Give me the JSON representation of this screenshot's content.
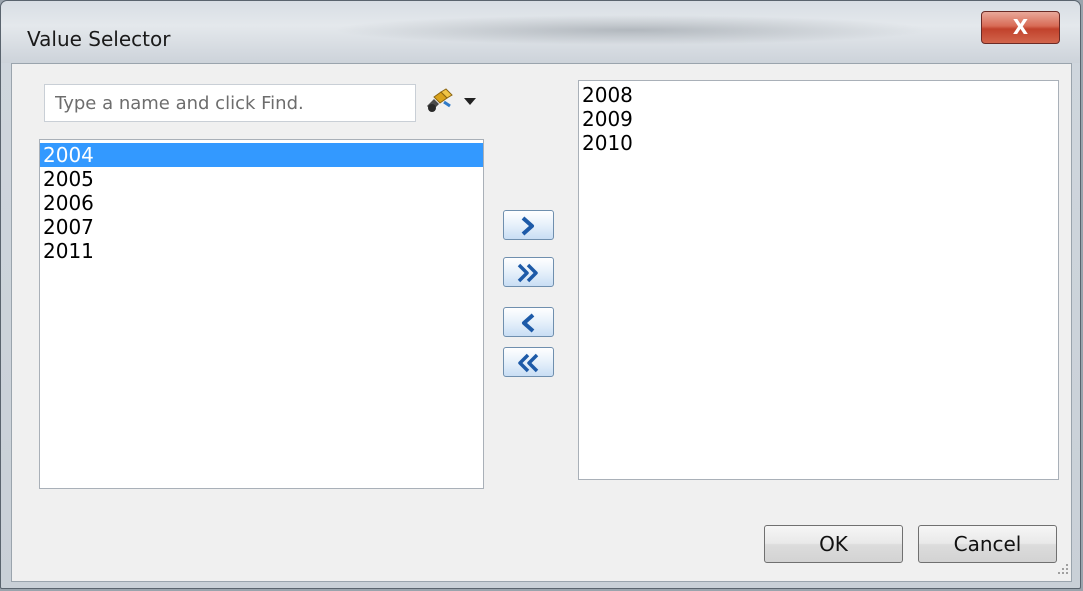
{
  "window": {
    "title": "Value Selector",
    "close_glyph": "X"
  },
  "search": {
    "placeholder": "Type a name and click Find.",
    "value": "",
    "find_icon": "find-binoculars-icon"
  },
  "available": {
    "items": [
      "2004",
      "2005",
      "2006",
      "2007",
      "2011"
    ],
    "selected": "2004"
  },
  "chosen": {
    "items": [
      "2008",
      "2009",
      "2010"
    ]
  },
  "move_buttons": {
    "add_one": "chevron-right-icon",
    "add_all": "double-chevron-right-icon",
    "remove_one": "chevron-left-icon",
    "remove_all": "double-chevron-left-icon"
  },
  "footer": {
    "ok_label": "OK",
    "cancel_label": "Cancel"
  },
  "colors": {
    "selection": "#3399ff",
    "close_button": "#c1422c",
    "arrow_button": "#2a6fbf"
  }
}
